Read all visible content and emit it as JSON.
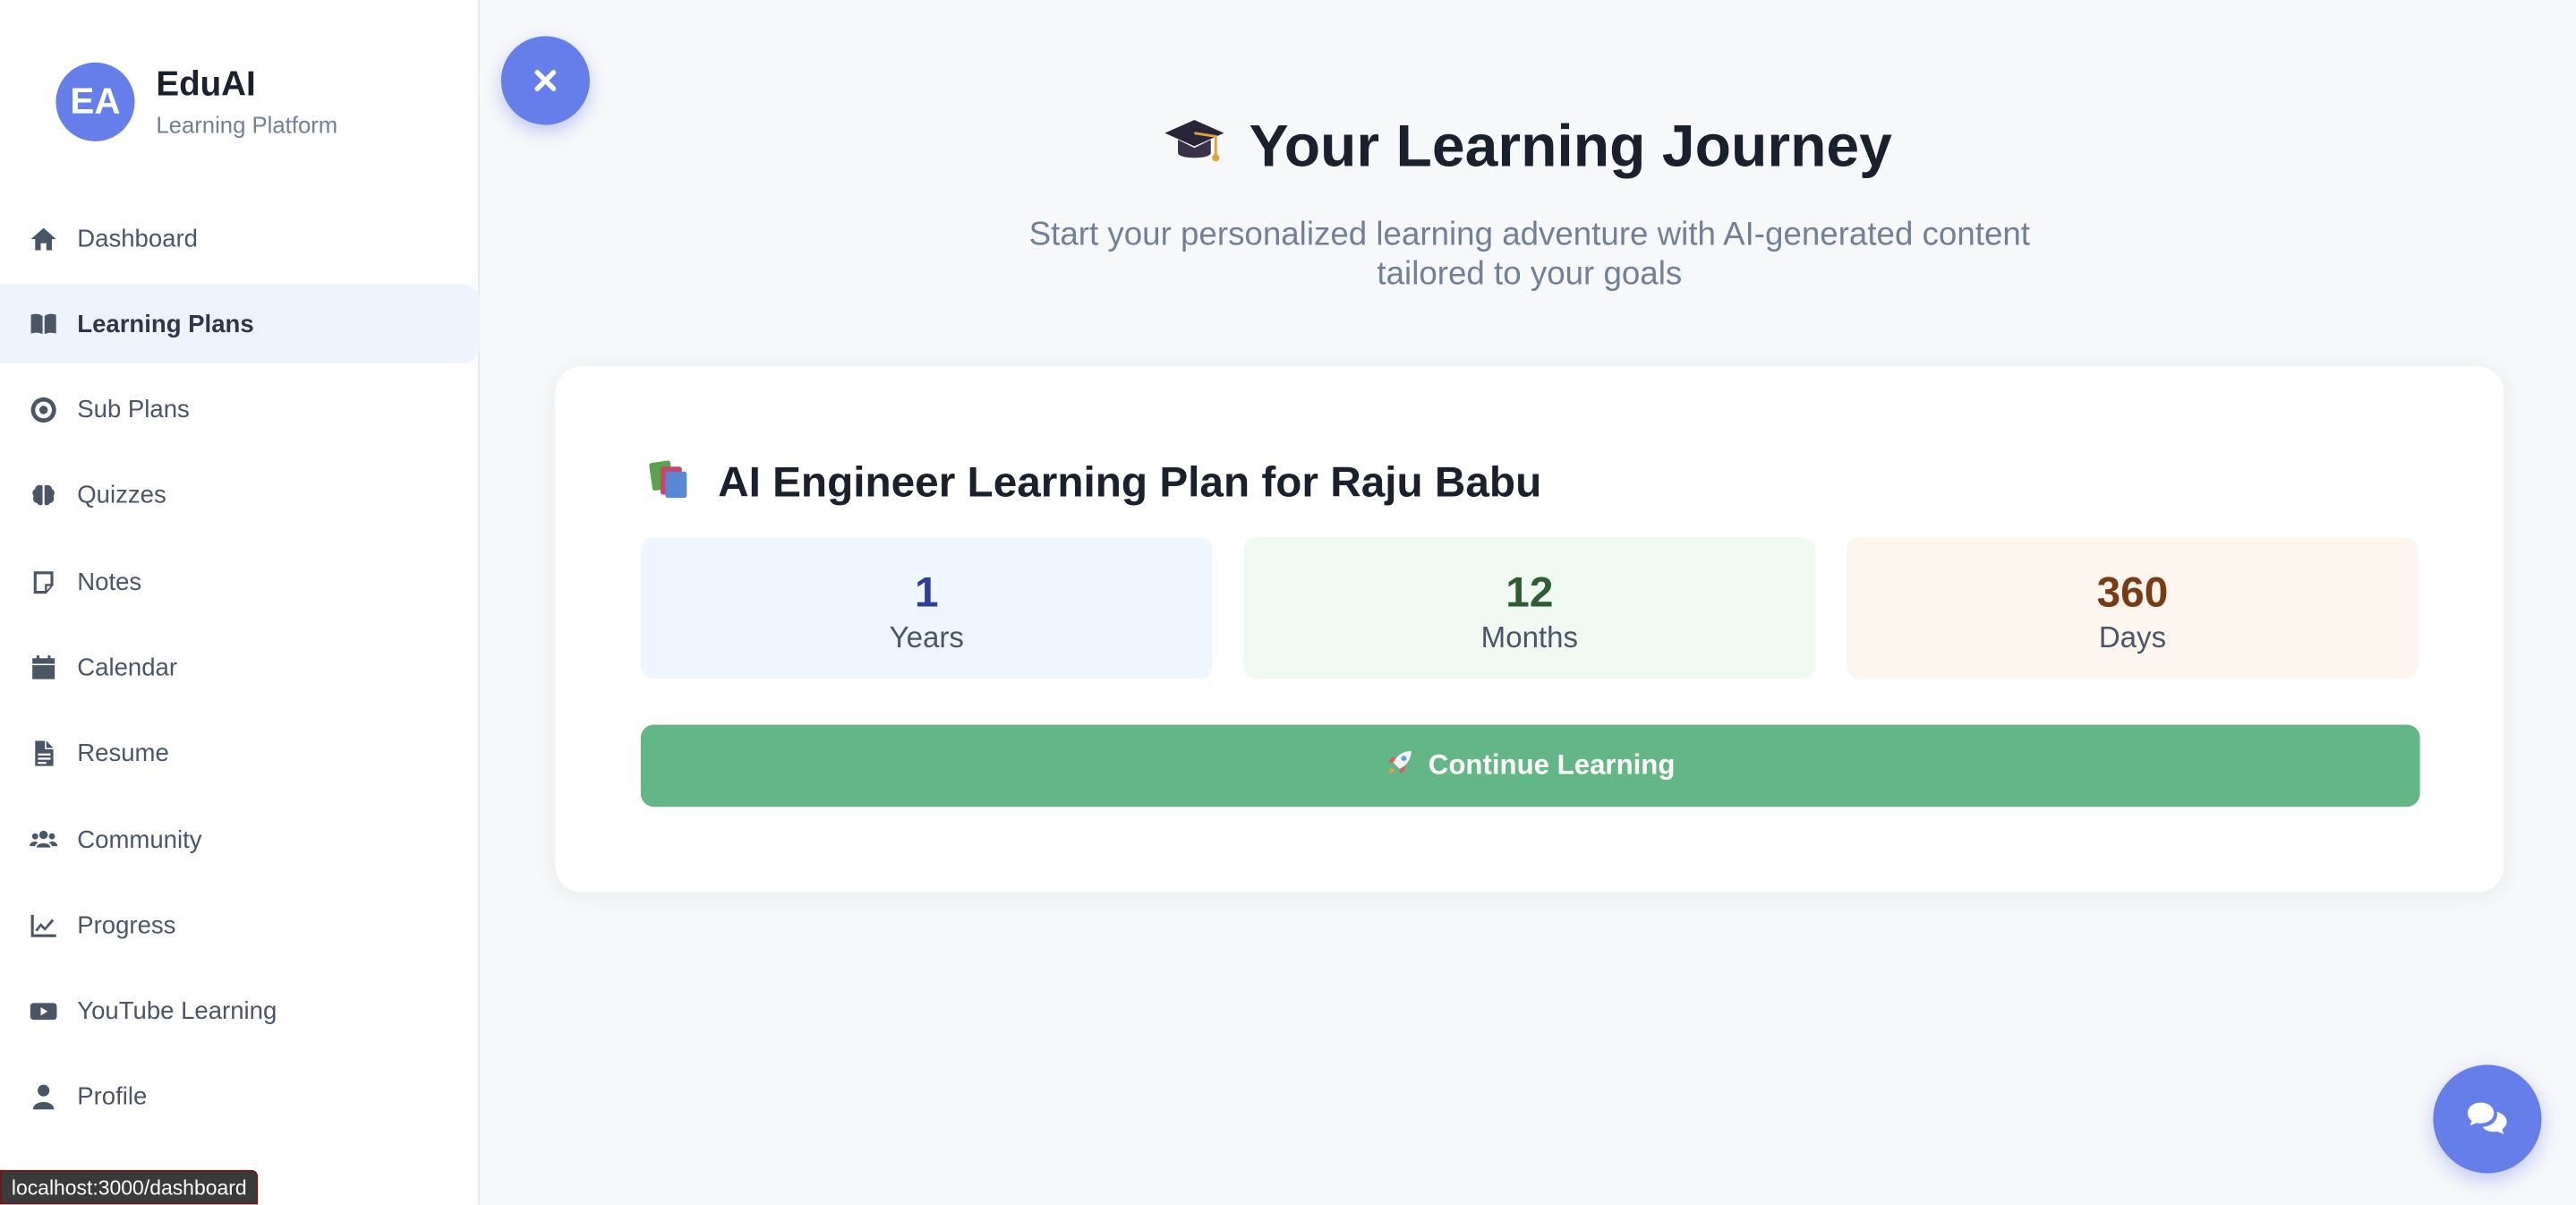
{
  "brand": {
    "initials": "EA",
    "name": "EduAI",
    "subtitle": "Learning Platform"
  },
  "sidebar": {
    "items": [
      {
        "label": "Dashboard",
        "icon": "home-icon"
      },
      {
        "label": "Learning Plans",
        "icon": "book-open-icon",
        "active": true
      },
      {
        "label": "Sub Plans",
        "icon": "target-icon"
      },
      {
        "label": "Quizzes",
        "icon": "brain-icon"
      },
      {
        "label": "Notes",
        "icon": "sticky-note-icon"
      },
      {
        "label": "Calendar",
        "icon": "calendar-icon"
      },
      {
        "label": "Resume",
        "icon": "file-icon"
      },
      {
        "label": "Community",
        "icon": "users-icon"
      },
      {
        "label": "Progress",
        "icon": "chart-line-icon"
      },
      {
        "label": "YouTube Learning",
        "icon": "youtube-icon"
      },
      {
        "label": "Profile",
        "icon": "user-icon"
      }
    ]
  },
  "status_bar": {
    "url": "localhost:3000/dashboard"
  },
  "hero": {
    "title": "Your Learning Journey",
    "subtitle": "Start your personalized learning adventure with AI-generated content tailored to your goals"
  },
  "plan": {
    "title": "AI Engineer Learning Plan for Raju Babu",
    "stats": {
      "years": {
        "value": "1",
        "label": "Years"
      },
      "months": {
        "value": "12",
        "label": "Months"
      },
      "days": {
        "value": "360",
        "label": "Days"
      }
    },
    "continue_label": "Continue Learning"
  },
  "colors": {
    "accent": "#667eea",
    "continue_button": "#63b786",
    "active_nav_bg": "#eef4fe"
  }
}
